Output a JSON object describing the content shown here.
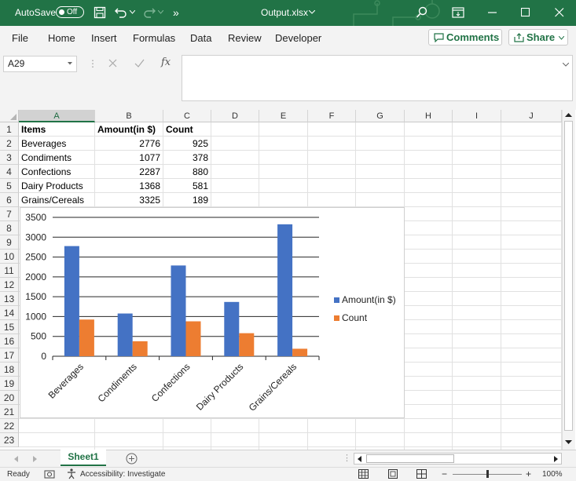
{
  "titlebar": {
    "autosave_label": "AutoSave",
    "autosave_state": "Off",
    "filename": "Output.xlsx",
    "more_label": "»"
  },
  "ribbon": {
    "menus": [
      "File",
      "Home",
      "Insert",
      "Formulas",
      "Data",
      "Review",
      "Developer"
    ],
    "comments_label": "Comments",
    "share_label": "Share"
  },
  "formula_bar": {
    "name_box": "A29",
    "fx_label": "fx",
    "formula": ""
  },
  "grid": {
    "columns": [
      "A",
      "B",
      "C",
      "D",
      "E",
      "F",
      "G",
      "H",
      "I",
      "J"
    ],
    "rows": [
      "1",
      "2",
      "3",
      "4",
      "5",
      "6",
      "7",
      "8",
      "9",
      "10",
      "11",
      "12",
      "13",
      "14",
      "15",
      "16",
      "17",
      "18",
      "19",
      "20",
      "21",
      "22",
      "23"
    ],
    "header_row": [
      "Items",
      "Amount(in $)",
      "Count"
    ],
    "data_rows": [
      [
        "Beverages",
        "2776",
        "925"
      ],
      [
        "Condiments",
        "1077",
        "378"
      ],
      [
        "Confections",
        "2287",
        "880"
      ],
      [
        "Dairy Products",
        "1368",
        "581"
      ],
      [
        "Grains/Cereals",
        "3325",
        "189"
      ]
    ]
  },
  "chart_data": {
    "type": "bar",
    "categories": [
      "Beverages",
      "Condiments",
      "Confections",
      "Dairy Products",
      "Grains/Cereals"
    ],
    "series": [
      {
        "name": "Amount(in $)",
        "values": [
          2776,
          1077,
          2287,
          1368,
          3325
        ],
        "color": "#4472c4"
      },
      {
        "name": "Count",
        "values": [
          925,
          378,
          880,
          581,
          189
        ],
        "color": "#ed7d31"
      }
    ],
    "ylim": [
      0,
      3500
    ],
    "yticks": [
      "0",
      "500",
      "1000",
      "1500",
      "2000",
      "2500",
      "3000",
      "3500"
    ],
    "grid": true,
    "legend": "right",
    "title": "",
    "xlabel": "",
    "ylabel": ""
  },
  "sheets": {
    "active": "Sheet1"
  },
  "status": {
    "ready": "Ready",
    "accessibility": "Accessibility: Investigate",
    "zoom": "100%",
    "zoom_minus": "−",
    "zoom_plus": "+"
  }
}
